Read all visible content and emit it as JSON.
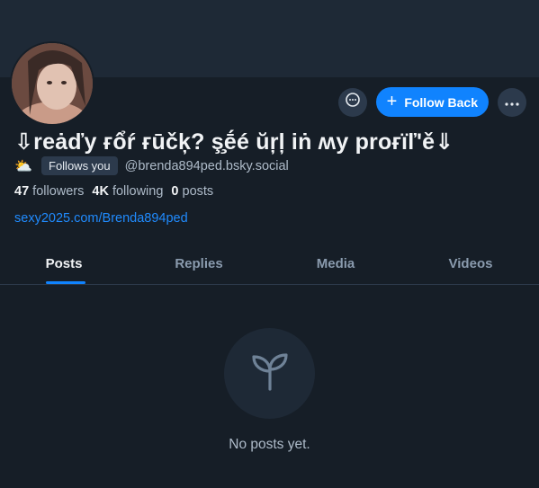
{
  "profile": {
    "display_name": "⇩reȧďy ғổŕ ғūčķ? ş̧ḗé ŭŗļ iṅ ʍy proғïľ'ě⇓",
    "follows_you_label": "Follows you",
    "handle": "@brenda894ped.bsky.social",
    "status_emoji": "⛅",
    "link": "sexy2025.com/Brenda894ped"
  },
  "stats": {
    "followers_count": "47",
    "followers_label": "followers",
    "following_count": "4K",
    "following_label": "following",
    "posts_count": "0",
    "posts_label": "posts"
  },
  "actions": {
    "follow_back_label": "Follow Back",
    "follow_plus": "+"
  },
  "tabs": [
    {
      "label": "Posts",
      "active": true
    },
    {
      "label": "Replies",
      "active": false
    },
    {
      "label": "Media",
      "active": false
    },
    {
      "label": "Videos",
      "active": false
    }
  ],
  "empty_state": {
    "icon": "seedling-icon",
    "text": "No posts yet."
  },
  "colors": {
    "background": "#161e27",
    "banner": "#1e2936",
    "accent": "#1083fe",
    "link": "#208bfe",
    "muted_text": "#aebbc9"
  }
}
